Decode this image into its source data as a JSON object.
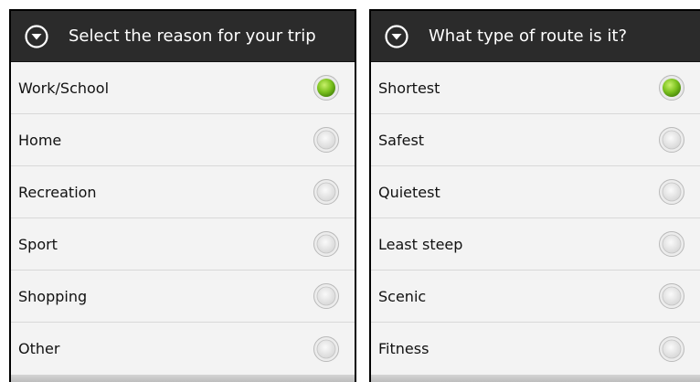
{
  "dialogs": {
    "trip_reason": {
      "title": "Select the reason for your trip",
      "header_icon": "chevron-down-circle-icon",
      "options": [
        {
          "label": "Work/School",
          "selected": true
        },
        {
          "label": "Home",
          "selected": false
        },
        {
          "label": "Recreation",
          "selected": false
        },
        {
          "label": "Sport",
          "selected": false
        },
        {
          "label": "Shopping",
          "selected": false
        },
        {
          "label": "Other",
          "selected": false
        }
      ]
    },
    "route_type": {
      "title": "What type of route is it?",
      "header_icon": "chevron-down-circle-icon",
      "options": [
        {
          "label": "Shortest",
          "selected": true
        },
        {
          "label": "Safest",
          "selected": false
        },
        {
          "label": "Quietest",
          "selected": false
        },
        {
          "label": "Least steep",
          "selected": false
        },
        {
          "label": "Scenic",
          "selected": false
        },
        {
          "label": "Fitness",
          "selected": false
        }
      ]
    }
  },
  "colors": {
    "header_bg": "#2b2b2b",
    "selected_radio": "#7cc21f",
    "row_bg": "#f3f3f3"
  }
}
